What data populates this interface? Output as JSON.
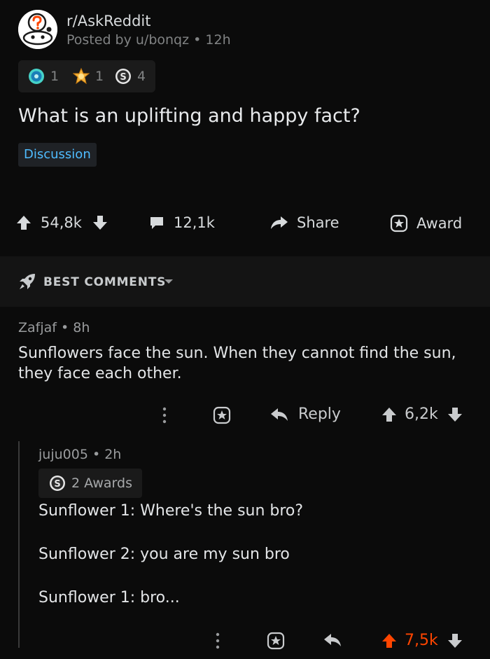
{
  "post": {
    "subreddit": "r/AskReddit",
    "posted_by": "Posted by u/bonqz",
    "time": "12h",
    "awards": [
      {
        "icon": "helpful-award-icon",
        "count": "1"
      },
      {
        "icon": "wholesome-award-icon",
        "count": "1"
      },
      {
        "icon": "silver-award-icon",
        "count": "4"
      }
    ],
    "title": "What is an uplifting and happy fact?",
    "flair": "Discussion",
    "votes": "54,8k",
    "comments": "12,1k",
    "share_label": "Share",
    "award_label": "Award"
  },
  "sort": {
    "label": "BEST COMMENTS"
  },
  "comments": [
    {
      "author": "Zafjaf",
      "time": "8h",
      "body": "Sunflowers face the sun.  When they cannot find the sun, they face each other.",
      "reply_label": "Reply",
      "score": "6,2k",
      "replies": [
        {
          "author": "juju005",
          "time": "2h",
          "awards_label": "2 Awards",
          "lines": [
            "Sunflower 1: Where's the sun bro?",
            "Sunflower 2: you are my sun bro",
            "Sunflower 1: bro..."
          ],
          "score": "7,5k"
        }
      ]
    }
  ],
  "colors": {
    "background": "#0b0b0b",
    "upvoted": "#ff4500",
    "flair_text": "#4fbcff",
    "muted": "#818384"
  }
}
